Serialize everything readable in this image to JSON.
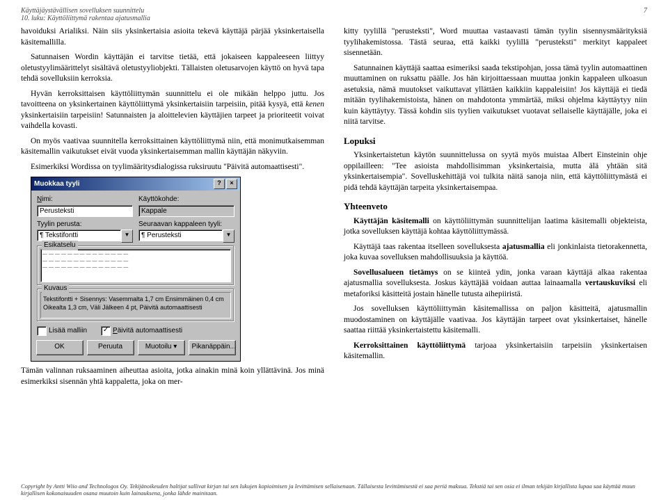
{
  "header": {
    "left_line1": "Käyttäjäystävällisen sovelluksen suunnittelu",
    "left_line2": "10. luku: Käyttöliittymä rakentaa ajatusmallia",
    "page_number": "7"
  },
  "left_col": {
    "p1": "havoiduksi Arialiksi. Näin siis yksinkertaisia asioita tekevä käyttäjä pärjää yksinkertaisella käsitemallilla.",
    "p2": "Satunnaisen Wordin käyttäjän ei tarvitse tietää, että jokaiseen kappaleeseen liittyy oletustyylimäärittelyt sisältävä oletustyyliobjekti. Tällaisten oletusarvojen käyttö on hyvä tapa tehdä sovelluksiin kerroksia.",
    "p3a": "Hyvän kerroksittaisen käyttöliittymän suunnittelu ei ole mikään helppo juttu. Jos tavoitteena on yksinkertainen käyttöliittymä yksinkertaisiin tarpeisiin, pitää kysyä, että ",
    "p3_em": "kenen",
    "p3b": " yksinkertaisiin tarpeisiin! Satunnaisten ja aloittelevien käyttäjien tarpeet ja prioriteetit voivat vaihdella kovasti.",
    "p4": "On myös vaativaa suunnitella kerroksittainen käyttöliittymä niin, että monimutkaisemman käsitemallin vaikutukset eivät vuoda yksinkertaisemman mallin käyttäjän näkyviin.",
    "p5": "Esimerkiksi Wordissa on tyylimääritysdialogissa ruksiruutu \"Päivitä automaattisesti\".",
    "p6": "Tämän valinnan ruksaaminen aiheuttaa asioita, jotka ainakin minä koin yllättävinä. Jos minä esimerkiksi sisennän yhtä kappaletta, joka on mer-"
  },
  "right_col": {
    "p1": "kitty tyylillä \"perusteksti\", Word muuttaa vastaavasti tämän tyylin sisennysmäärityksiä tyylihakemistossa. Tästä seuraa, että kaikki tyylillä \"perusteksti\" merkityt kappaleet sisennetään.",
    "p2": "Satunnainen käyttäjä saattaa esimeriksi saada tekstipohjan, jossa tämä tyylin automaattinen muuttaminen on ruksattu päälle. Jos hän kirjoittaessaan muuttaa jonkin kappaleen ulkoasun asetuksia, nämä muutokset vaikuttavat yllättäen kaikkiin kappaleisiin! Jos käyttäjä ei tiedä mitään tyylihakemistoista, hänen on mahdotonta ymmärtää, miksi ohjelma käyttäytyy niin kuin käyttäytyy. Tässä kohdin siis tyylien vaikutukset vuotavat sellaiselle käyttäjälle, joka ei niitä tarvitse.",
    "h_lopuksi": "Lopuksi",
    "p3": "Yksinkertaistetun käytön suunnittelussa on syytä myös muistaa Albert Einsteinin ohje oppilailleen: \"Tee asioista mahdollisimman yksinkertaisia, mutta älä yhtään sitä yksinkertaisempia\". Sovelluskehittäjä voi tulkita näitä sanoja niin, että käyttöliittymästä ei pidä tehdä käyttäjän tarpeita yksinkertaisempaa.",
    "h_yhteenveto": "Yhteenveto",
    "p4a": "Käyttäjän käsitemalli",
    "p4b": " on käyttöliittymän suunnittelijan laatima käsitemalli objekteista, jotka sovelluksen käyttäjä kohtaa käyttöliittymässä.",
    "p5a": "Käyttäjä taas rakentaa itselleen sovelluksesta ",
    "p5b": "ajatusmallia",
    "p5c": " eli jonkinlaista tietorakennetta, joka kuvaa sovelluksen mahdollisuuksia ja käyttöä.",
    "p6a": "Sovellusalueen tietämys",
    "p6b": " on se kiinteä ydin, jonka varaan käyttäjä alkaa rakentaa ajatusmallia sovelluksesta. Joskus käyttäjää voidaan auttaa lainaamalla ",
    "p6c": "vertauskuviksi",
    "p6d": " eli metaforiksi käsitteitä jostain hänelle tutusta aihepiiristä.",
    "p7": "Jos sovelluksen käyttöliittymän käsitemallissa on paljon käsitteitä, ajatusmallin muodostaminen on käyttäjälle vaativaa. Jos käyttäjän tarpeet ovat yksinkertaiset, hänelle saattaa riittää yksinkertaistettu käsitemalli.",
    "p8a": "Kerroksittainen käyttöliittymä",
    "p8b": " tarjoaa yksinkertaisiin tarpeisiin yksinkertaisen käsitemallin."
  },
  "dialog": {
    "title": "Muokkaa tyyli",
    "help_btn": "?",
    "close_btn": "×",
    "lbl_nimi": "Nimi:",
    "val_nimi": "Perusteksti",
    "lbl_kohde": "Käyttökohde:",
    "val_kohde": "Kappale",
    "lbl_perusta": "Tyylin perusta:",
    "val_perusta": "¶ Tekstifontti",
    "lbl_seuraava": "Seuraavan kappaleen tyyli:",
    "val_seuraava": "¶ Perusteksti",
    "grp_esikatselu": "Esikatselu",
    "grp_kuvaus": "Kuvaus",
    "kuvaus_text": "Tekstifontti + Sisennys: Vasemmalta 1,7 cm Ensimmäinen 0,4 cm Oikealta 1,3 cm, Väli Jälkeen 4 pt, Päivitä automaattisesti",
    "chk_lisaa": "Lisää malliin",
    "chk_paivita": "Päivitä automaattisesti",
    "btn_ok": "OK",
    "btn_peruuta": "Peruuta",
    "btn_muotoilu": "Muotoilu",
    "btn_pika": "Pikanäppäin..."
  },
  "footer": {
    "text": "Copyright by Antti Wiio and Technologos Oy. Tekijänoikeuden haltijat sallivat kirjan tai sen lukujen kopioimisen ja levittämisen sellaisenaan. Tällaisesta levittämisestä ei saa periä maksua. Tekstiä tai sen osia ei ilman tekijän kirjallista lupaa saa käyttää muun kirjallisen kokonaisuuden osana muutoin kuin lainauksena, jonka lähde mainitaan."
  }
}
